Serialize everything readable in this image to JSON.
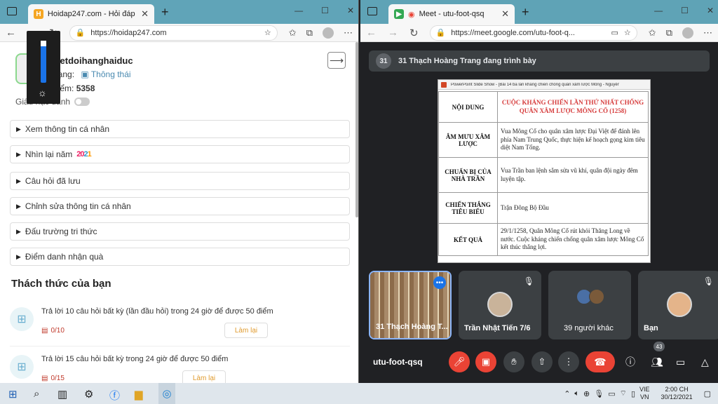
{
  "left_browser": {
    "tab_title": "Hoidap247.com - Hỏi đáp bài tậ",
    "url": "https://hoidap247.com",
    "profile": {
      "username": "metdoihanghaiduc",
      "rank_label": "Hạng:",
      "rank_value": "Thông thái",
      "points_label": "Điểm:",
      "points_value": "5358",
      "anon_label": "Giấu nặc danh"
    },
    "menu": [
      "Xem thông tin cá nhân",
      "Nhìn lại năm",
      "Câu hỏi đã lưu",
      "Chỉnh sửa thông tin cá nhân",
      "Đấu trường tri thức",
      "Điểm danh nhận quà"
    ],
    "year_badge": [
      "20",
      "2",
      "1"
    ],
    "challenges_title": "Thách thức của bạn",
    "challenges": [
      {
        "text": "Trả lời 10 câu hỏi  bất kỳ (lần đầu hỏi) trong 24 giờ để được 50 điểm",
        "count": "0/10",
        "button": "Làm lại"
      },
      {
        "text": "Trả lời 15 câu hỏi  bất kỳ  trong 24 giờ để được 50 điểm",
        "count": "0/15",
        "button": "Làm lại"
      }
    ]
  },
  "right_browser": {
    "tab_title": "Meet - utu-foot-qsq",
    "url": "https://meet.google.com/utu-foot-q...",
    "presenter_num": "31",
    "presenting_text": "31 Thạch Hoàng Trang đang trình bày",
    "slide": {
      "window_title": "PowerPoint Slide Show - [Bài 14 ba lần kháng chiến chống quân xâm lược Mông - Nguyên ...",
      "rows": [
        {
          "header": "NỘI DUNG",
          "content": "CUỘC KHÁNG CHIẾN LẦN THỨ NHẤT CHỐNG QUÂN XÂM LƯỢC MÔNG CỔ (1258)"
        },
        {
          "header": "ÂM MƯU XÂM LƯỢC",
          "content": "Vua Mông Cổ cho quân xâm lược Đại Việt để đánh lên phía Nam Trung Quốc, thực hiện kế hoạch gọng kìm tiêu diệt Nam Tống."
        },
        {
          "header": "CHUẨN BỊ CỦA NHÀ TRẦN",
          "content": "Vua Trần ban lệnh sắm sửa vũ khí, quân đội ngày đêm luyện tập."
        },
        {
          "header": "CHIẾN THẮNG TIÊU BIỂU",
          "content": "Trận Đông Bộ Đầu"
        },
        {
          "header": "KẾT QUẢ",
          "content": "29/1/1258, Quân Mông Cổ rút khỏi Thăng Long về nước. Cuộc kháng chiến chống quân xâm lược Mông Cổ kết thúc thắng lợi."
        }
      ]
    },
    "tiles": [
      {
        "name": "31 Thạch Hoàng T..."
      },
      {
        "name": "Trần Nhật Tiến 7/6"
      },
      {
        "name": "39 người khác"
      },
      {
        "name": "Bạn"
      }
    ],
    "meeting_code": "utu-foot-qsq",
    "participant_count": "43"
  },
  "taskbar": {
    "lang_top": "VIE",
    "lang_bottom": "VN",
    "time": "2:00 CH",
    "date": "30/12/2021"
  },
  "colors": {
    "tabbar": "#60a4b8",
    "meet_bg": "#202124",
    "danger": "#ea4335",
    "rank": "#4a8ab0",
    "slide_red": "#d63a3a"
  }
}
